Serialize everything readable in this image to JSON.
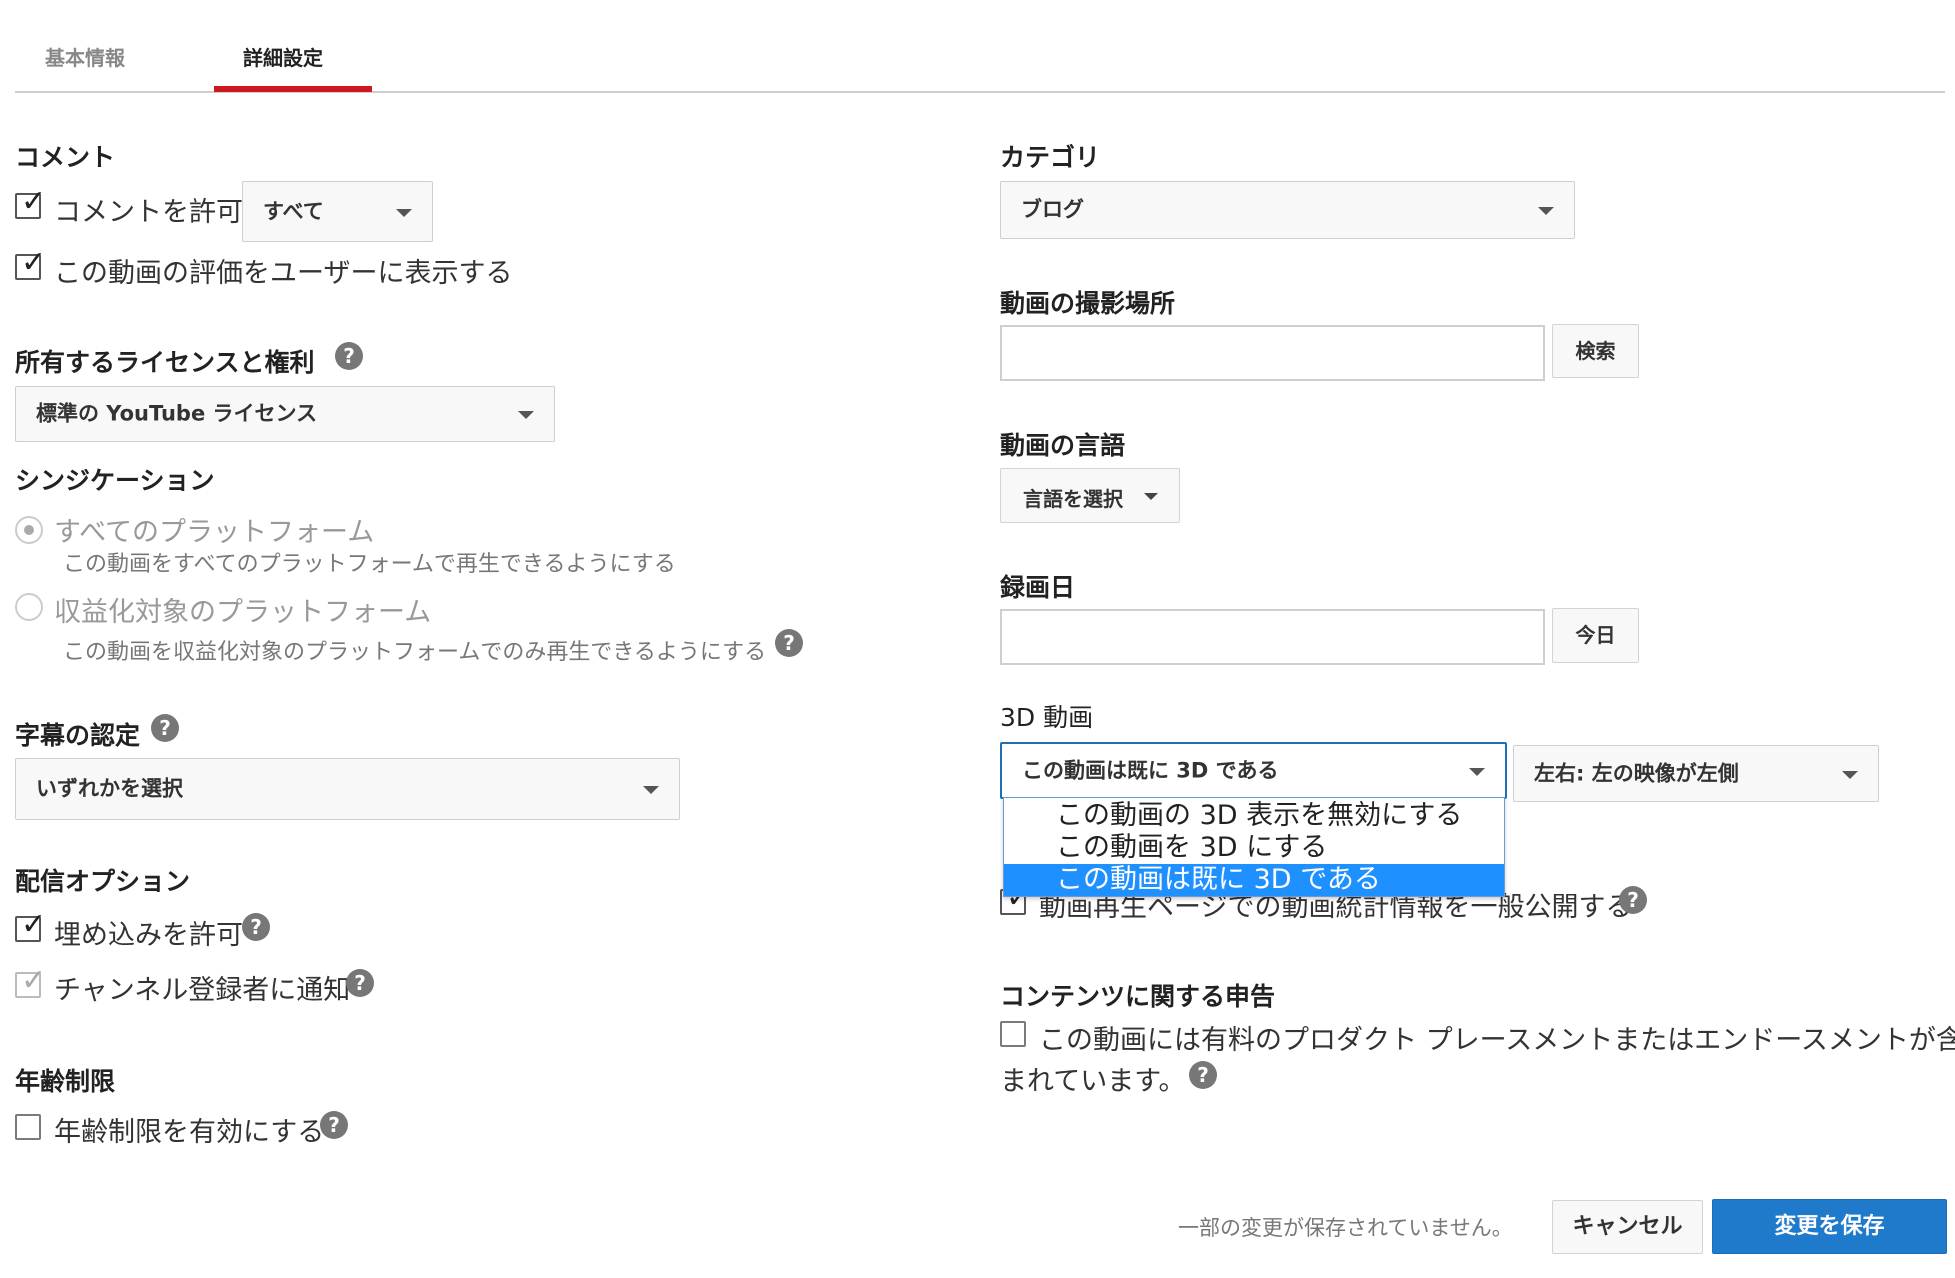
{
  "tabs": [
    {
      "label": "基本情報",
      "active": false
    },
    {
      "label": "詳細設定",
      "active": true
    }
  ],
  "accent_color": "#cc181e",
  "primary_color": "#1f7acc",
  "left": {
    "comments": {
      "heading": "コメント",
      "allow_label": "コメントを許可",
      "allow_checked": true,
      "allow_select": "すべて",
      "show_rating_label": "この動画の評価をユーザーに表示する",
      "show_rating_checked": true
    },
    "license": {
      "heading": "所有するライセンスと権利",
      "select": "標準の YouTube ライセンス"
    },
    "syndication": {
      "heading": "シンジケーション",
      "all_label": "すべてのプラットフォーム",
      "all_desc": "この動画をすべてのプラットフォームで再生できるようにする",
      "mon_label": "収益化対象のプラットフォーム",
      "mon_desc": "この動画を収益化対象のプラットフォームでのみ再生できるようにする"
    },
    "captions": {
      "heading": "字幕の認定",
      "select": "いずれかを選択"
    },
    "distribution": {
      "heading": "配信オプション",
      "embed_label": "埋め込みを許可",
      "notify_label": "チャンネル登録者に通知"
    },
    "age": {
      "heading": "年齢制限",
      "label": "年齢制限を有効にする"
    }
  },
  "right": {
    "category": {
      "heading": "カテゴリ",
      "select": "ブログ"
    },
    "location": {
      "heading": "動画の撮影場所",
      "button": "検索",
      "value": ""
    },
    "language": {
      "heading": "動画の言語",
      "button": "言語を選択"
    },
    "recording_date": {
      "heading": "録画日",
      "button": "今日",
      "value": ""
    },
    "video3d": {
      "heading": "3D 動画",
      "select": "この動画は既に 3D である",
      "layout_select": "左右: 左の映像が左側",
      "menu": [
        "この動画の 3D 表示を無効にする",
        "この動画を 3D にする",
        "この動画は既に 3D である"
      ]
    },
    "stats_label": "動画再生ページでの動画統計情報を一般公開する",
    "content": {
      "heading": "コンテンツに関する申告",
      "label_line1": "この動画には有料のプロダクト プレースメントまたはエンドースメントが含",
      "label_line2": "まれています。"
    }
  },
  "footer": {
    "status": "一部の変更が保存されていません。",
    "cancel": "キャンセル",
    "save": "変更を保存"
  }
}
